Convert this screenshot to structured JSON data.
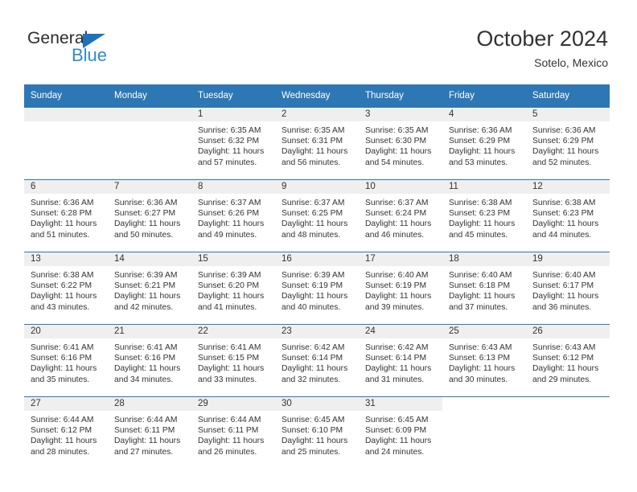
{
  "brand": {
    "name_part1": "General",
    "name_part2": "Blue",
    "triangle_color": "#1f72b8",
    "blue_color": "#2e8bd0"
  },
  "header": {
    "title": "October 2024",
    "location": "Sotelo, Mexico"
  },
  "theme": {
    "header_blue": "#2e77b5",
    "daynum_band": "#efefef",
    "text": "#333333"
  },
  "weekdays": [
    "Sunday",
    "Monday",
    "Tuesday",
    "Wednesday",
    "Thursday",
    "Friday",
    "Saturday"
  ],
  "weeks": [
    [
      {
        "day": "",
        "sunrise": "",
        "sunset": "",
        "daylight1": "",
        "daylight2": "",
        "empty": true
      },
      {
        "day": "",
        "sunrise": "",
        "sunset": "",
        "daylight1": "",
        "daylight2": "",
        "empty": true
      },
      {
        "day": "1",
        "sunrise": "Sunrise: 6:35 AM",
        "sunset": "Sunset: 6:32 PM",
        "daylight1": "Daylight: 11 hours",
        "daylight2": "and 57 minutes."
      },
      {
        "day": "2",
        "sunrise": "Sunrise: 6:35 AM",
        "sunset": "Sunset: 6:31 PM",
        "daylight1": "Daylight: 11 hours",
        "daylight2": "and 56 minutes."
      },
      {
        "day": "3",
        "sunrise": "Sunrise: 6:35 AM",
        "sunset": "Sunset: 6:30 PM",
        "daylight1": "Daylight: 11 hours",
        "daylight2": "and 54 minutes."
      },
      {
        "day": "4",
        "sunrise": "Sunrise: 6:36 AM",
        "sunset": "Sunset: 6:29 PM",
        "daylight1": "Daylight: 11 hours",
        "daylight2": "and 53 minutes."
      },
      {
        "day": "5",
        "sunrise": "Sunrise: 6:36 AM",
        "sunset": "Sunset: 6:29 PM",
        "daylight1": "Daylight: 11 hours",
        "daylight2": "and 52 minutes."
      }
    ],
    [
      {
        "day": "6",
        "sunrise": "Sunrise: 6:36 AM",
        "sunset": "Sunset: 6:28 PM",
        "daylight1": "Daylight: 11 hours",
        "daylight2": "and 51 minutes."
      },
      {
        "day": "7",
        "sunrise": "Sunrise: 6:36 AM",
        "sunset": "Sunset: 6:27 PM",
        "daylight1": "Daylight: 11 hours",
        "daylight2": "and 50 minutes."
      },
      {
        "day": "8",
        "sunrise": "Sunrise: 6:37 AM",
        "sunset": "Sunset: 6:26 PM",
        "daylight1": "Daylight: 11 hours",
        "daylight2": "and 49 minutes."
      },
      {
        "day": "9",
        "sunrise": "Sunrise: 6:37 AM",
        "sunset": "Sunset: 6:25 PM",
        "daylight1": "Daylight: 11 hours",
        "daylight2": "and 48 minutes."
      },
      {
        "day": "10",
        "sunrise": "Sunrise: 6:37 AM",
        "sunset": "Sunset: 6:24 PM",
        "daylight1": "Daylight: 11 hours",
        "daylight2": "and 46 minutes."
      },
      {
        "day": "11",
        "sunrise": "Sunrise: 6:38 AM",
        "sunset": "Sunset: 6:23 PM",
        "daylight1": "Daylight: 11 hours",
        "daylight2": "and 45 minutes."
      },
      {
        "day": "12",
        "sunrise": "Sunrise: 6:38 AM",
        "sunset": "Sunset: 6:23 PM",
        "daylight1": "Daylight: 11 hours",
        "daylight2": "and 44 minutes."
      }
    ],
    [
      {
        "day": "13",
        "sunrise": "Sunrise: 6:38 AM",
        "sunset": "Sunset: 6:22 PM",
        "daylight1": "Daylight: 11 hours",
        "daylight2": "and 43 minutes."
      },
      {
        "day": "14",
        "sunrise": "Sunrise: 6:39 AM",
        "sunset": "Sunset: 6:21 PM",
        "daylight1": "Daylight: 11 hours",
        "daylight2": "and 42 minutes."
      },
      {
        "day": "15",
        "sunrise": "Sunrise: 6:39 AM",
        "sunset": "Sunset: 6:20 PM",
        "daylight1": "Daylight: 11 hours",
        "daylight2": "and 41 minutes."
      },
      {
        "day": "16",
        "sunrise": "Sunrise: 6:39 AM",
        "sunset": "Sunset: 6:19 PM",
        "daylight1": "Daylight: 11 hours",
        "daylight2": "and 40 minutes."
      },
      {
        "day": "17",
        "sunrise": "Sunrise: 6:40 AM",
        "sunset": "Sunset: 6:19 PM",
        "daylight1": "Daylight: 11 hours",
        "daylight2": "and 39 minutes."
      },
      {
        "day": "18",
        "sunrise": "Sunrise: 6:40 AM",
        "sunset": "Sunset: 6:18 PM",
        "daylight1": "Daylight: 11 hours",
        "daylight2": "and 37 minutes."
      },
      {
        "day": "19",
        "sunrise": "Sunrise: 6:40 AM",
        "sunset": "Sunset: 6:17 PM",
        "daylight1": "Daylight: 11 hours",
        "daylight2": "and 36 minutes."
      }
    ],
    [
      {
        "day": "20",
        "sunrise": "Sunrise: 6:41 AM",
        "sunset": "Sunset: 6:16 PM",
        "daylight1": "Daylight: 11 hours",
        "daylight2": "and 35 minutes."
      },
      {
        "day": "21",
        "sunrise": "Sunrise: 6:41 AM",
        "sunset": "Sunset: 6:16 PM",
        "daylight1": "Daylight: 11 hours",
        "daylight2": "and 34 minutes."
      },
      {
        "day": "22",
        "sunrise": "Sunrise: 6:41 AM",
        "sunset": "Sunset: 6:15 PM",
        "daylight1": "Daylight: 11 hours",
        "daylight2": "and 33 minutes."
      },
      {
        "day": "23",
        "sunrise": "Sunrise: 6:42 AM",
        "sunset": "Sunset: 6:14 PM",
        "daylight1": "Daylight: 11 hours",
        "daylight2": "and 32 minutes."
      },
      {
        "day": "24",
        "sunrise": "Sunrise: 6:42 AM",
        "sunset": "Sunset: 6:14 PM",
        "daylight1": "Daylight: 11 hours",
        "daylight2": "and 31 minutes."
      },
      {
        "day": "25",
        "sunrise": "Sunrise: 6:43 AM",
        "sunset": "Sunset: 6:13 PM",
        "daylight1": "Daylight: 11 hours",
        "daylight2": "and 30 minutes."
      },
      {
        "day": "26",
        "sunrise": "Sunrise: 6:43 AM",
        "sunset": "Sunset: 6:12 PM",
        "daylight1": "Daylight: 11 hours",
        "daylight2": "and 29 minutes."
      }
    ],
    [
      {
        "day": "27",
        "sunrise": "Sunrise: 6:44 AM",
        "sunset": "Sunset: 6:12 PM",
        "daylight1": "Daylight: 11 hours",
        "daylight2": "and 28 minutes."
      },
      {
        "day": "28",
        "sunrise": "Sunrise: 6:44 AM",
        "sunset": "Sunset: 6:11 PM",
        "daylight1": "Daylight: 11 hours",
        "daylight2": "and 27 minutes."
      },
      {
        "day": "29",
        "sunrise": "Sunrise: 6:44 AM",
        "sunset": "Sunset: 6:11 PM",
        "daylight1": "Daylight: 11 hours",
        "daylight2": "and 26 minutes."
      },
      {
        "day": "30",
        "sunrise": "Sunrise: 6:45 AM",
        "sunset": "Sunset: 6:10 PM",
        "daylight1": "Daylight: 11 hours",
        "daylight2": "and 25 minutes."
      },
      {
        "day": "31",
        "sunrise": "Sunrise: 6:45 AM",
        "sunset": "Sunset: 6:09 PM",
        "daylight1": "Daylight: 11 hours",
        "daylight2": "and 24 minutes."
      },
      {
        "day": "",
        "sunrise": "",
        "sunset": "",
        "daylight1": "",
        "daylight2": "",
        "blank": true
      },
      {
        "day": "",
        "sunrise": "",
        "sunset": "",
        "daylight1": "",
        "daylight2": "",
        "blank": true
      }
    ]
  ]
}
